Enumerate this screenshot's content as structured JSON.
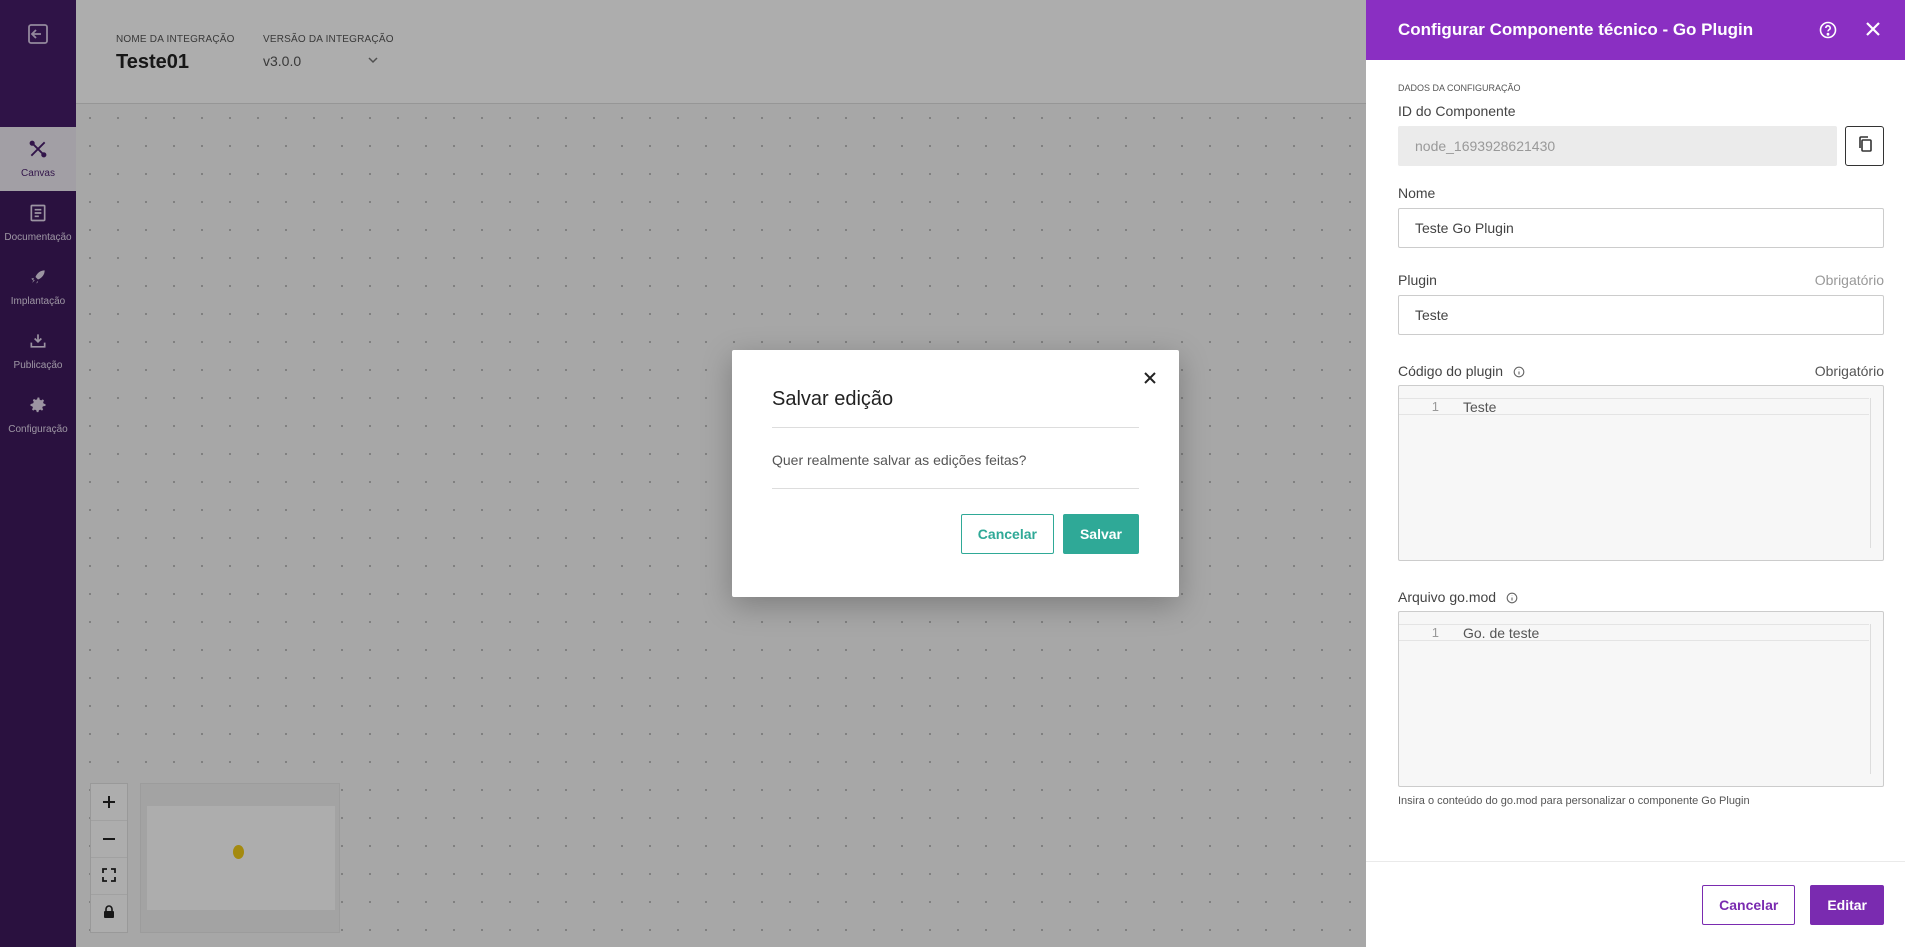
{
  "sidebar": {
    "items": [
      {
        "label": "Canvas",
        "icon": "canvas-tools-icon"
      },
      {
        "label": "Documentação",
        "icon": "document-icon"
      },
      {
        "label": "Implantação",
        "icon": "rocket-icon"
      },
      {
        "label": "Publicação",
        "icon": "download-tray-icon"
      },
      {
        "label": "Configuração",
        "icon": "gear-icon"
      }
    ]
  },
  "header": {
    "name_label": "NOME DA INTEGRAÇÃO",
    "name": "Teste01",
    "version_label": "VERSÃO DA INTEGRAÇÃO",
    "version": "v3.0.0"
  },
  "modal": {
    "title": "Salvar edição",
    "message": "Quer realmente salvar as edições feitas?",
    "cancel": "Cancelar",
    "confirm": "Salvar"
  },
  "panel": {
    "title": "Configurar Componente técnico - Go Plugin",
    "section": "DADOS DA CONFIGURAÇÃO",
    "component_id_label": "ID do Componente",
    "component_id": "node_1693928621430",
    "name_label": "Nome",
    "name_value": "Teste Go Plugin",
    "plugin_label": "Plugin",
    "plugin_required": "Obrigatório",
    "plugin_value": "Teste",
    "code_label": "Código do plugin",
    "code_required": "Obrigatório",
    "code_line_no": "1",
    "code_value": "Teste",
    "gomod_label": "Arquivo go.mod",
    "gomod_line_no": "1",
    "gomod_value": "Go. de teste",
    "gomod_hint": "Insira o conteúdo do go.mod para personalizar o componente Go Plugin",
    "cancel": "Cancelar",
    "edit": "Editar"
  },
  "colors": {
    "sidebar": "#3f1a5e",
    "panel_header": "#8a2fc2",
    "teal": "#2fa997",
    "purple_button": "#7a2bb0"
  }
}
